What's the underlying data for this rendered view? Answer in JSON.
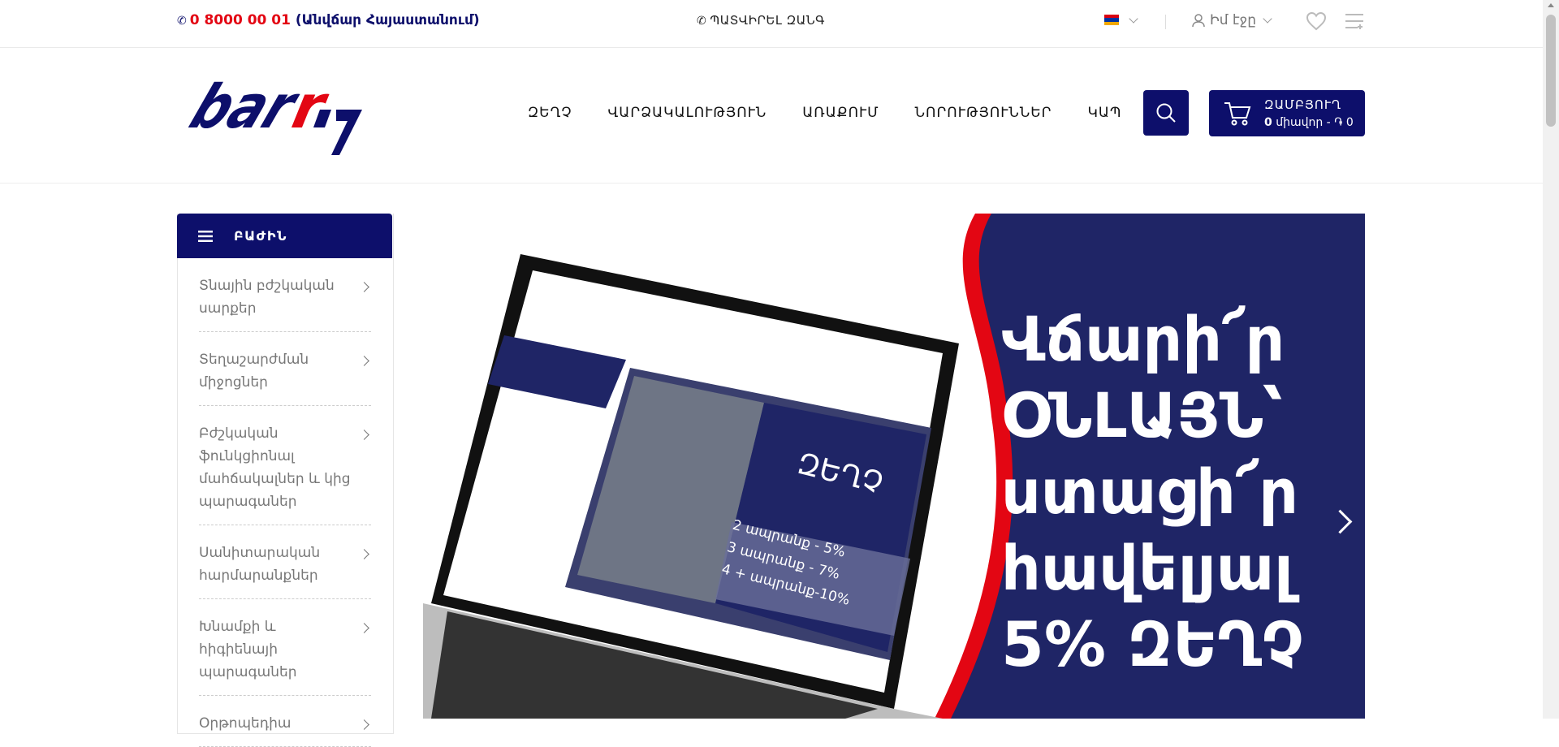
{
  "topbar": {
    "phone_number": "0 8000 00 01",
    "phone_note": "(Անվճար Հայաստանում)",
    "callback_label": "ՊԱՏՎԻՐԵԼ ԶԱՆԳ",
    "account_label": "Իմ էջը"
  },
  "header": {
    "logo_text": "barry",
    "nav": [
      "ԶԵՂՉ",
      "ՎԱՐՁԱԿԱԼՈՒԹՅՈՒՆ",
      "ԱՌԱՔՈՒՄ",
      "ՆՈՐՈՒԹՅՈՒՆՆԵՐ",
      "ԿԱՊ"
    ],
    "cart_title": "ԶԱՄԲՅՈՒՂ",
    "cart_count": "0",
    "cart_summary": " միավոր - ֏ 0"
  },
  "sidebar": {
    "title": "ԲԱԺԻՆ",
    "items": [
      "Տնային բժշկական սարքեր",
      "Տեղաշարժման միջոցներ",
      "Բժշկական ֆունկցիոնալ մահճակալներ և կից պարագաներ",
      "Սանիտարական հարմարանքներ",
      "Խնամքի և հիգիենայի պարագաներ",
      "Օրթոպեդիա"
    ]
  },
  "banner": {
    "promo_lines": [
      "Վճարի՜ր",
      "ՕՆԼԱՅՆ՝",
      "ստացի՜ր",
      "հավելյալ",
      "5% ԶԵՂՉ"
    ],
    "screen_title": "ԶԵՂՉ",
    "screen_offers": [
      "2 ապրանք - 5%",
      "3 ապրանք - 7%",
      "4 + ապրանք-10%"
    ]
  },
  "colors": {
    "brand": "#0d0f6b",
    "accent": "#e30613",
    "banner_blue": "#1f2566"
  }
}
